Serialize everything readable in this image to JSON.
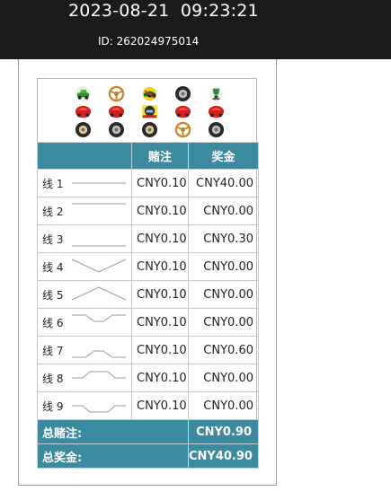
{
  "header": {
    "datetime": "2023-08-21  09:23:21",
    "id_text": "ID: 262024975014"
  },
  "reels": [
    [
      "car-icon",
      "steering-wheel-icon",
      "helmet-icon",
      "tire-icon",
      "trophy-icon"
    ],
    [
      "racecar-red-icon",
      "racecar-red-icon",
      "wild-helmet-icon",
      "racecar-red-icon",
      "racecar-red-icon"
    ],
    [
      "tire-icon",
      "tire-icon",
      "tire-icon",
      "steering-wheel-icon",
      "tire-icon"
    ]
  ],
  "table": {
    "headers": [
      "",
      "赌注",
      "奖金"
    ],
    "rows": [
      {
        "line": "线 1",
        "bet": "CNY0.10",
        "win": "CNY40.00"
      },
      {
        "line": "线 2",
        "bet": "CNY0.10",
        "win": "CNY0.00"
      },
      {
        "line": "线 3",
        "bet": "CNY0.10",
        "win": "CNY0.30"
      },
      {
        "line": "线 4",
        "bet": "CNY0.10",
        "win": "CNY0.00"
      },
      {
        "line": "线 5",
        "bet": "CNY0.10",
        "win": "CNY0.00"
      },
      {
        "line": "线 6",
        "bet": "CNY0.10",
        "win": "CNY0.00"
      },
      {
        "line": "线 7",
        "bet": "CNY0.10",
        "win": "CNY0.60"
      },
      {
        "line": "线 8",
        "bet": "CNY0.10",
        "win": "CNY0.00"
      },
      {
        "line": "线 9",
        "bet": "CNY0.10",
        "win": "CNY0.00"
      }
    ],
    "total_bet_label": "总赌注:",
    "total_bet": "CNY0.90",
    "total_win_label": "总奖金:",
    "total_win": "CNY40.90"
  },
  "colors": {
    "header_bg": "#1b1b1b",
    "table_accent": "#3c8aa0"
  }
}
